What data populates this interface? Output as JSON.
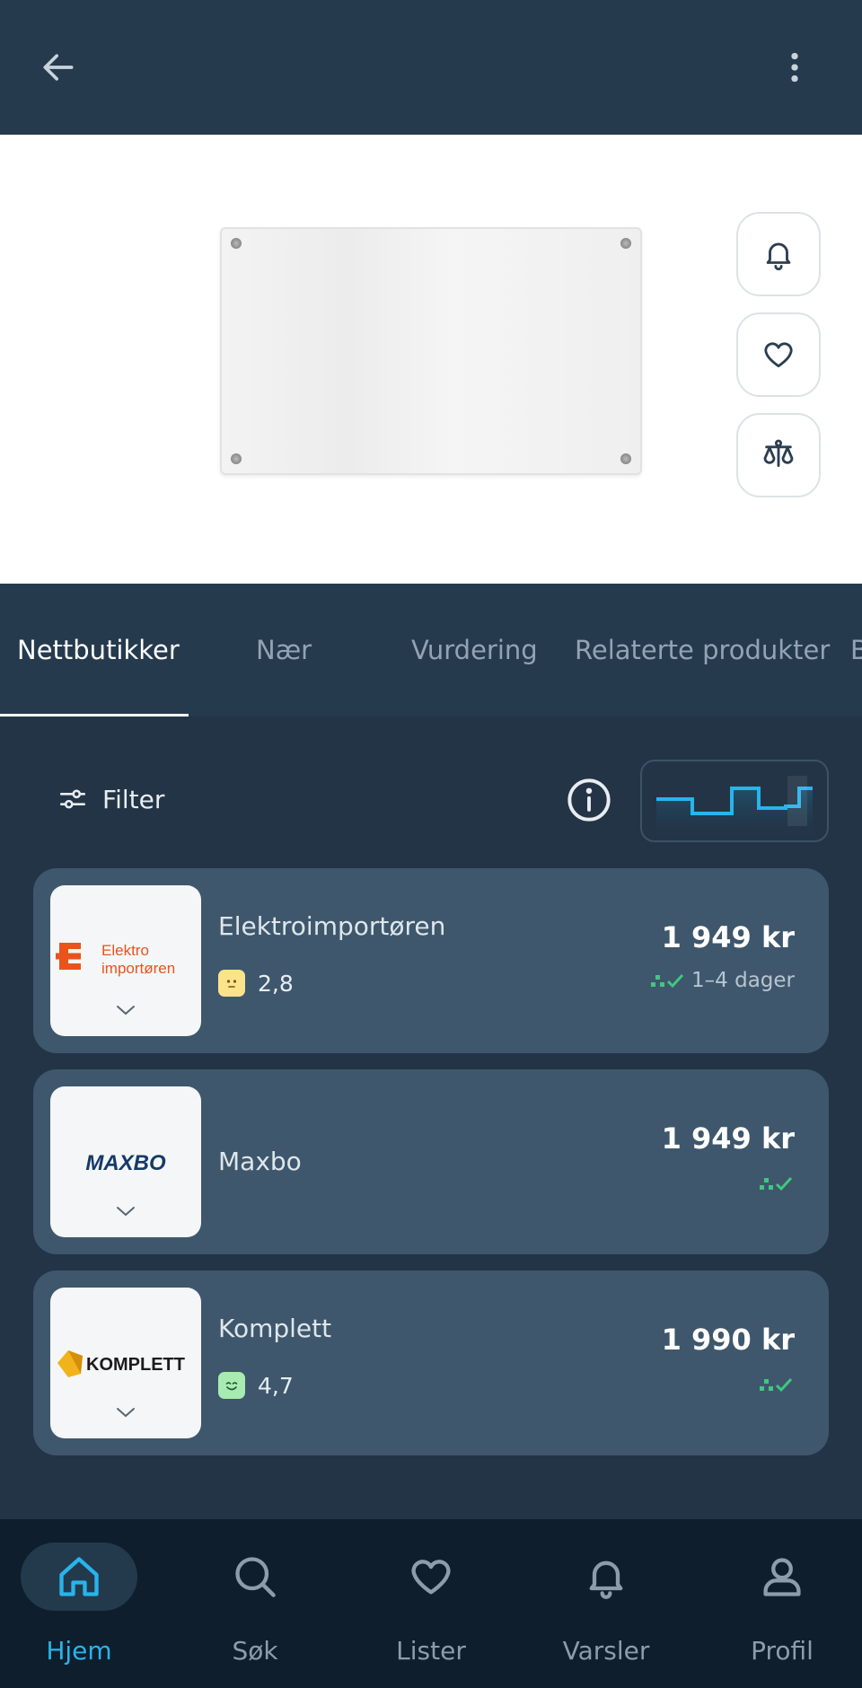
{
  "header": {
    "back_icon": "arrow-left-icon",
    "more_icon": "more-vertical-icon"
  },
  "hero": {
    "actions": [
      {
        "name": "price-alert-button",
        "icon": "bell-icon"
      },
      {
        "name": "favorite-button",
        "icon": "heart-icon"
      },
      {
        "name": "compare-button",
        "icon": "scale-icon"
      }
    ]
  },
  "tabs": [
    {
      "label": "Nettbutikker",
      "active": true
    },
    {
      "label": "Nær",
      "active": false
    },
    {
      "label": "Vurdering",
      "active": false
    },
    {
      "label": "Relaterte produkter",
      "active": false
    },
    {
      "label": "B",
      "active": false
    }
  ],
  "filter": {
    "label": "Filter",
    "icon": "sliders-icon",
    "info_icon": "info-icon",
    "chart_icon": "price-history-icon"
  },
  "price_history_sparkline": [
    2,
    2,
    1,
    1,
    3,
    3,
    1,
    1,
    2
  ],
  "offers": [
    {
      "store": "Elektroimportøren",
      "logo_text_1": "Elektro",
      "logo_text_2": "importøren",
      "rating": "2,8",
      "rating_mood": "neutral",
      "price": "1 949 kr",
      "delivery": "1–4 dager"
    },
    {
      "store": "Maxbo",
      "logo_text": "MAXBO",
      "rating": "",
      "price": "1 949 kr",
      "delivery": ""
    },
    {
      "store": "Komplett",
      "logo_text": "KOMPLETT",
      "rating": "4,7",
      "rating_mood": "happy",
      "price": "1 990 kr",
      "delivery": ""
    }
  ],
  "nav": [
    {
      "label": "Hjem",
      "icon": "home-icon",
      "active": true
    },
    {
      "label": "Søk",
      "icon": "search-icon",
      "active": false
    },
    {
      "label": "Lister",
      "icon": "heart-icon",
      "active": false
    },
    {
      "label": "Varsler",
      "icon": "bell-icon",
      "active": false
    },
    {
      "label": "Profil",
      "icon": "user-icon",
      "active": false
    }
  ],
  "colors": {
    "accent": "#28b4ec",
    "delivery_green": "#3fc87f",
    "background": "#233446",
    "card": "#3e576c"
  }
}
